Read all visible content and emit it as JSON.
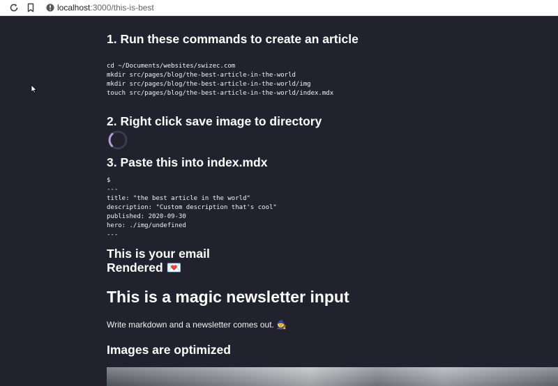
{
  "browser": {
    "url_host": "localhost",
    "url_path": ":3000/this-is-best"
  },
  "steps": {
    "step1_title": "1. Run these commands to create an article",
    "step1_code": "cd ~/Documents/websites/swizec.com\nmkdir src/pages/blog/the-best-article-in-the-world\nmkdir src/pages/blog/the-best-article-in-the-world/img\ntouch src/pages/blog/the-best-article-in-the-world/index.mdx",
    "step2_title": "2. Right click save image to directory",
    "step3_title": "3. Paste this into index.mdx",
    "step3_code": "$\n---\ntitle: \"the best article in the world\"\ndescription: \"Custom description that's cool\"\npublished: 2020-09-30\nhero: ./img/undefined\n---"
  },
  "email": {
    "line1": "This is your email",
    "line2": "Rendered",
    "line2_emoji": "💌"
  },
  "article": {
    "h1": "This is a magic newsletter input",
    "paragraph": "Write markdown and a newsletter comes out.",
    "paragraph_emoji": "🧙",
    "h2": "Images are optimized"
  },
  "colors": {
    "background": "#22222f",
    "spinner": "#b39ddb"
  },
  "icons": [
    "reload-icon",
    "bookmark-icon",
    "info-icon",
    "loading-spinner-icon",
    "mouse-cursor-icon"
  ]
}
